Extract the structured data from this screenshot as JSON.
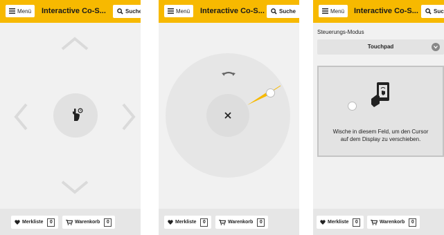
{
  "header": {
    "menu_label": "Menü",
    "title": "Interactive Co-S...",
    "search_label": "Suche"
  },
  "footer": {
    "wishlist_label": "Merkliste",
    "wishlist_count": "0",
    "cart_label": "Warenkorb",
    "cart_count": "0"
  },
  "panel3": {
    "mode_label": "Steuerungs-Modus",
    "mode_value": "Touchpad",
    "touch_instruction": "Wische in diesem Feld, um den Cursor auf dem Display zu verschieben."
  },
  "colors": {
    "accent": "#f7b900",
    "panel_bg": "#f1f1f1",
    "button_gray": "#e1e1e1",
    "footer_bg": "#e6e6e6"
  },
  "icons": [
    "menu-icon",
    "search-icon",
    "heart-icon",
    "cart-icon",
    "hand-pointer-icon",
    "close-icon",
    "rotate-icon",
    "tablet-touch-icon",
    "chevron-down-icon",
    "arrow-up-icon",
    "arrow-down-icon",
    "arrow-left-icon",
    "arrow-right-icon"
  ]
}
